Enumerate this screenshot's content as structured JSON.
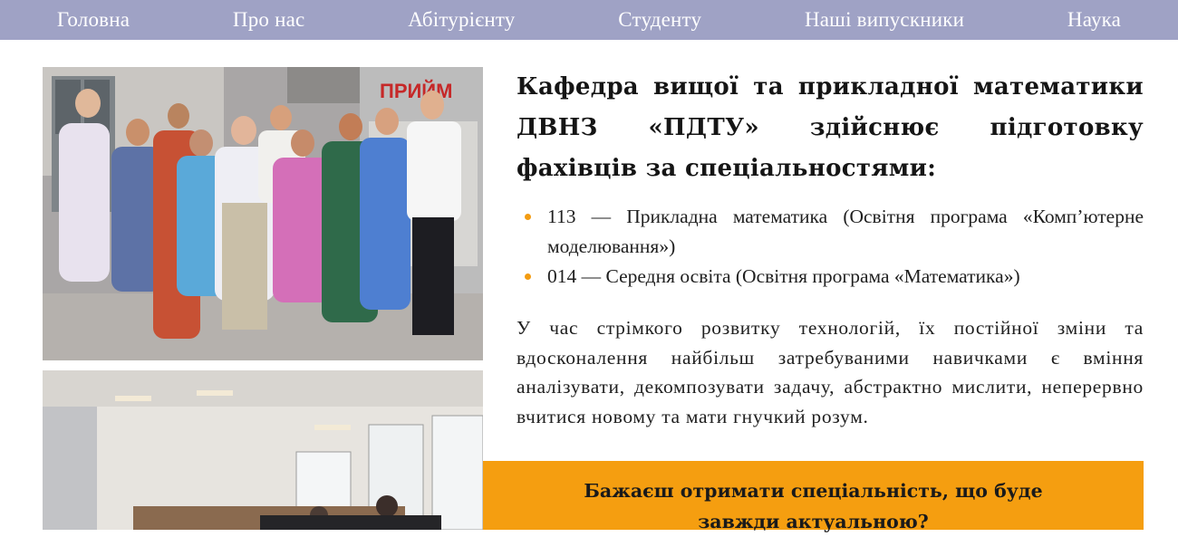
{
  "nav": {
    "items": [
      {
        "label": "Головна"
      },
      {
        "label": "Про нас"
      },
      {
        "label": "Абітурієнту"
      },
      {
        "label": "Студенту"
      },
      {
        "label": "Наші випускники"
      },
      {
        "label": "Наука"
      }
    ]
  },
  "photos": {
    "group_banner_text": "ПРИЙМ"
  },
  "main": {
    "heading": "Кафедра вищої та прикладної математики ДВНЗ «ПДТУ» здійснює підготовку фахівців за спеціальностями:",
    "programs": [
      {
        "text": "113 — Прикладна математика (Освітня програма «Комп’ютерне моделювання»)"
      },
      {
        "text": "014 — Середня освіта (Освітня програма «Математика»)"
      }
    ],
    "paragraph": "У час стрімкого розвитку технологій, їх постійної зміни та вдосконалення найбільш затребуваними навичками є вміння аналізувати, декомпозувати задачу, абстрактно мислити, неперервно вчитися новому та мати гнучкий розум.",
    "cta": "Бажаєш отримати спеціальність, що буде завжди актуальною?"
  },
  "colors": {
    "nav_bg": "#9fa2c5",
    "accent": "#f59e10",
    "bullet": "#f39c12"
  }
}
